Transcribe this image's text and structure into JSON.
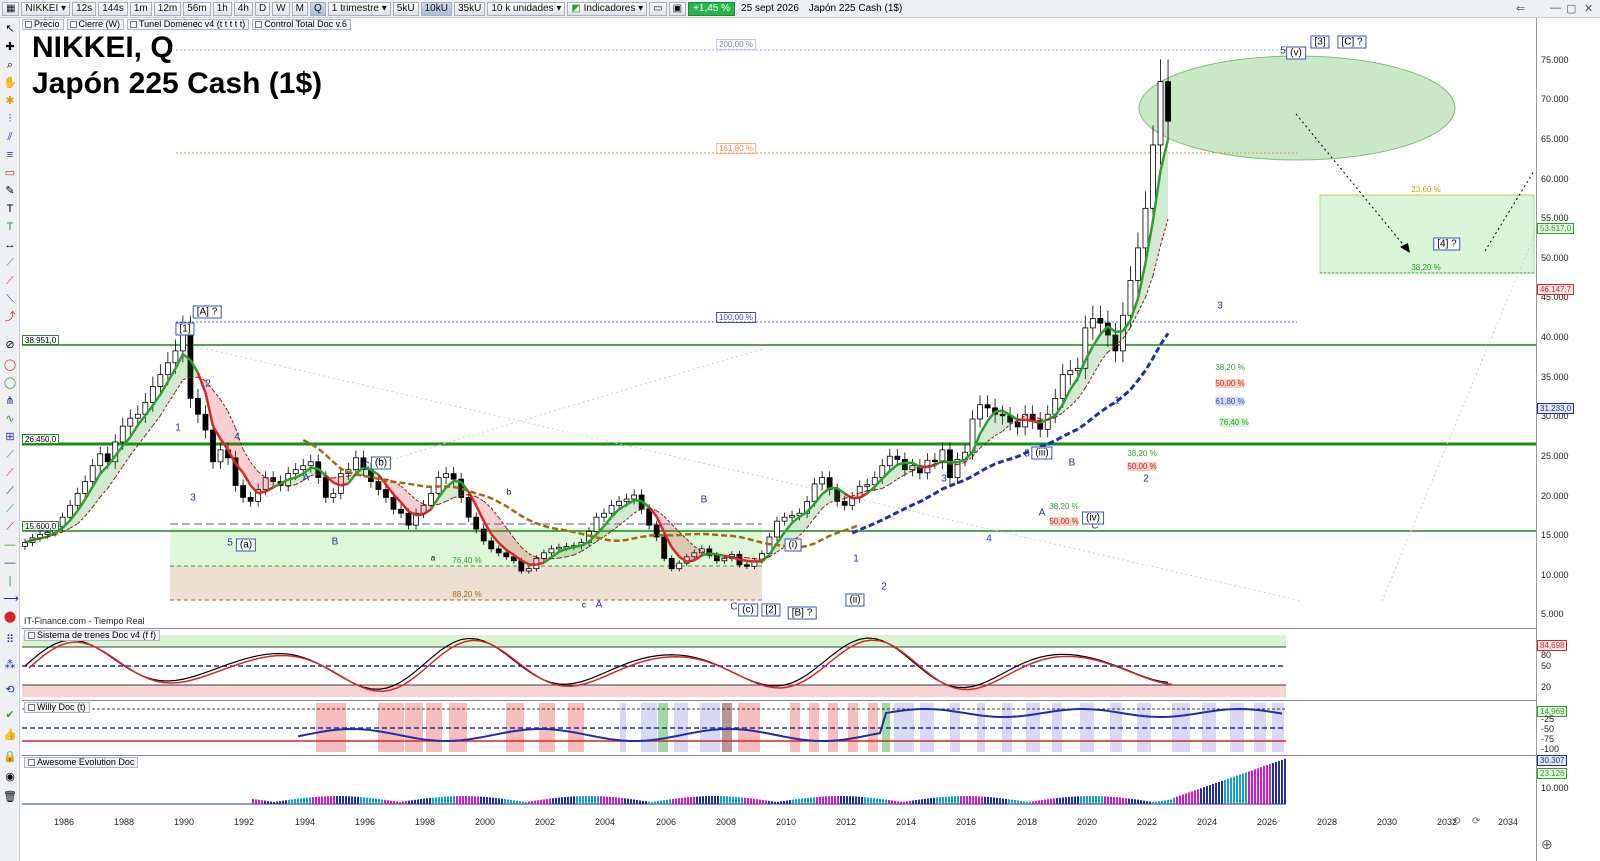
{
  "toolbar": {
    "symbol": "NIKKEI",
    "timeframes": [
      "12s",
      "144s",
      "1m",
      "12m",
      "56m",
      "1h",
      "4h",
      "D",
      "W",
      "M",
      "Q"
    ],
    "active_timeframe": "Q",
    "period": "1 trimestre",
    "units_buttons": [
      "5kU",
      "10kU",
      "35kU"
    ],
    "active_unit": "10kU",
    "units_select": "10 k unidades",
    "indicators_label": "Indicadores",
    "change_badge": "+1,45 %",
    "date": "25 sept 2026",
    "instrument": "Japón 225 Cash (1$)"
  },
  "legend": {
    "items": [
      "Precio",
      "Cierre (W)",
      "Tunel Domenec v4 (t t t t t)",
      "Control Total Doc v.6"
    ]
  },
  "chart": {
    "title_line1": "NIKKEI, Q",
    "title_line2": "Japón 225 Cash (1$)",
    "source_note": "IT-Finance.com - Tiempo Real",
    "level_tags": [
      "38.951,0",
      "26.450,0",
      "15.600,0"
    ],
    "fib_labels": {
      "f200": "200,00 %",
      "f161": "161,80 %",
      "f100": "100,00 %",
      "f236": "23,60 %",
      "f382": "38,20 %",
      "f764": "76,40 %",
      "f882": "88,20 %",
      "f382b": "38,20 %",
      "f500": "50,00 %",
      "f382c": "38,20 %",
      "f500b": "50,00 %",
      "f382d": "38,20 %",
      "f500c": "50,00 %",
      "f618": "61,80 %",
      "f764b": "76,40 %"
    },
    "waves": {
      "w_A_top": "[A] ?",
      "w_1_top": "[1]",
      "w_2": "2",
      "w_1": "1",
      "w_3": "3",
      "w_4": "4",
      "w_5a": "5",
      "w_a": "(a)",
      "w_A1": "A",
      "w_B1": "B",
      "w_C1": "C",
      "w_b": "(b)",
      "w_a_small": "a",
      "w_b_small": "b",
      "w_c_small": "c",
      "w_A2": "A",
      "w_B2": "B",
      "w_C2": "C",
      "w_c": "(c)",
      "w_2b": "[2]",
      "w_Bq": "[B] ?",
      "w_i": "(i)",
      "w_ii": "(ii)",
      "w_1b": "1",
      "w_2c": "2",
      "w_3b": "3",
      "w_4b": "4",
      "w_5b": "5",
      "w_iii": "(iii)",
      "w_A3": "A",
      "w_B3": "B",
      "w_C3": "C",
      "w_iv": "(iv)",
      "w_1c": "1",
      "w_2d": "2",
      "w_3c": "3",
      "w_5c": "5",
      "w_v": "(v)",
      "w_3box": "[3]",
      "w_Cq": "[C] ?",
      "w_4q": "[4] ?"
    }
  },
  "price_axis": {
    "labels": [
      "75.000",
      "70.000",
      "65.000",
      "60.000",
      "55.000",
      "50.000",
      "45.000",
      "40.000",
      "35.000",
      "30.000",
      "25.000",
      "20.000",
      "15.000",
      "10.000",
      "5.000"
    ],
    "tags": {
      "t1": "53.617,0",
      "t2": "46.147,7",
      "t3": "31.233,0"
    }
  },
  "indicators": {
    "ind1_title": "Sistema de trenes Doc v4 (f f)",
    "ind1_value": "84,698",
    "ind1_axis": [
      "80",
      "50",
      "20"
    ],
    "ind2_title": "Willy Doc (t)",
    "ind2_value": "14,969",
    "ind2_axis": [
      "-25",
      "-50",
      "-75",
      "-100"
    ],
    "ind3_title": "Awesome Evolution Doc",
    "ind3_value": "30.307",
    "ind3_value2": "23.126",
    "ind3_axis": [
      "10.000"
    ]
  },
  "time_axis": {
    "years": [
      "1986",
      "1988",
      "1990",
      "1992",
      "1994",
      "1996",
      "1998",
      "2000",
      "2002",
      "2004",
      "2006",
      "2008",
      "2010",
      "2012",
      "2014",
      "2016",
      "2018",
      "2020",
      "2022",
      "2024",
      "2026",
      "2028",
      "2030",
      "2032",
      "2034"
    ]
  },
  "colors": {
    "up": "#2ca02c",
    "down": "#d62728",
    "level": "#1a8a1a",
    "blue": "#1f2fa8",
    "brown": "#a06a10"
  }
}
